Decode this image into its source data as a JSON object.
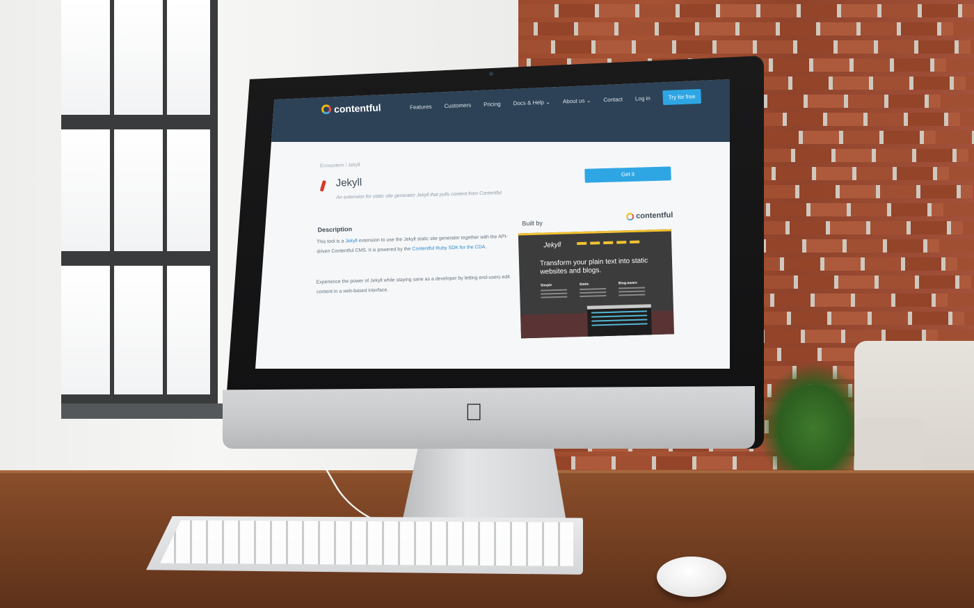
{
  "site": {
    "logo_text": "contentful",
    "nav": [
      "Features",
      "Customers",
      "Pricing",
      "Docs & Help ⌄",
      "About us ⌄",
      "Contact",
      "Log in"
    ],
    "cta": "Try for free"
  },
  "page": {
    "breadcrumb": "Ecosystem / Jekyll",
    "title": "Jekyll",
    "subtitle": "An extension for static site generator Jekyll that pulls content from Contentful",
    "get_button": "Get it",
    "description_heading": "Description",
    "description_p1_pre": "This tool is a ",
    "description_p1_link1": "Jekyll",
    "description_p1_mid": " extension to use the Jekyll static site generator together with the API-driven Contentful CMS. It is powered by the ",
    "description_p1_link2": "Contentful Ruby SDK for the CDA",
    "description_p1_post": ".",
    "description_p2": "Experience the power of Jekyll while staying sane as a developer by letting end-users edit content in a web-based interface.",
    "built_by": "Built by",
    "built_by_logo": "contentful"
  },
  "preview": {
    "logo": "Jekyll",
    "headline": "Transform your plain text into static websites and blogs.",
    "columns": [
      "Simple",
      "Static",
      "Blog-aware"
    ]
  },
  "colors": {
    "header": "#2d4256",
    "accent": "#2fa6e4",
    "link": "#2a89c7",
    "preview_yellow": "#f2c230"
  },
  "icons": {
    "apple": "apple-logo-icon"
  }
}
